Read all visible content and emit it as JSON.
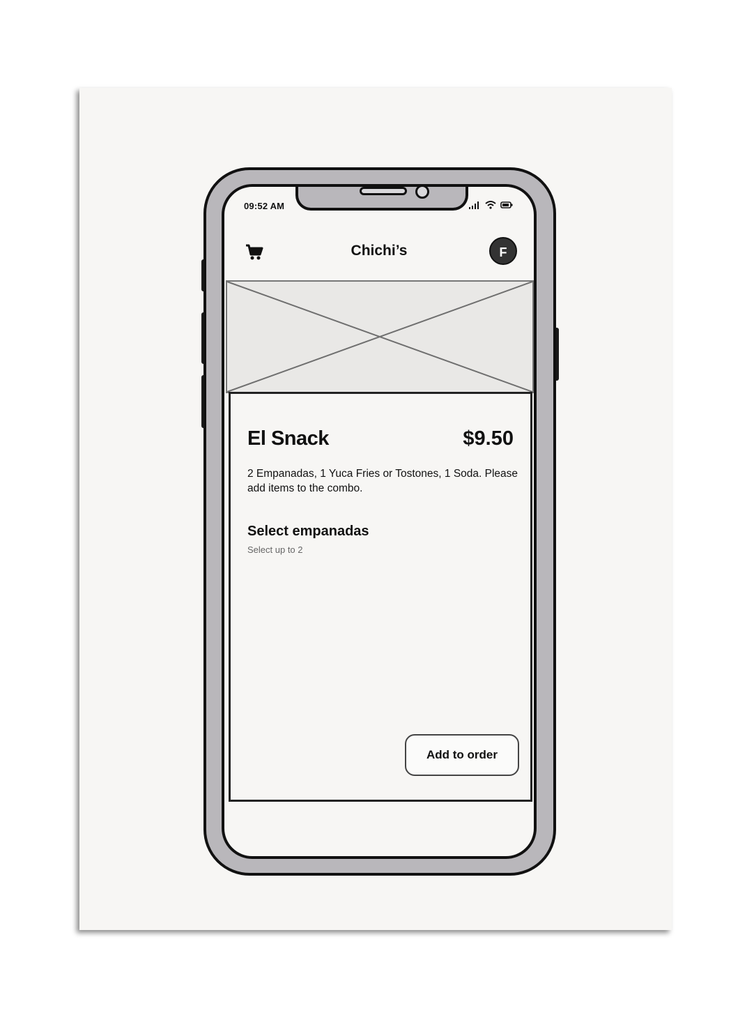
{
  "status_bar": {
    "time": "09:52 AM"
  },
  "header": {
    "title": "Chichi’s",
    "avatar_initial": "F"
  },
  "item": {
    "name": "El Snack",
    "price": "$9.50",
    "description": "2 Empanadas, 1 Yuca Fries or Tostones, 1 Soda. Please add items to the combo."
  },
  "selection": {
    "title": "Select empanadas",
    "subtitle": "Select up to 2"
  },
  "actions": {
    "add_to_order": "Add to order"
  }
}
